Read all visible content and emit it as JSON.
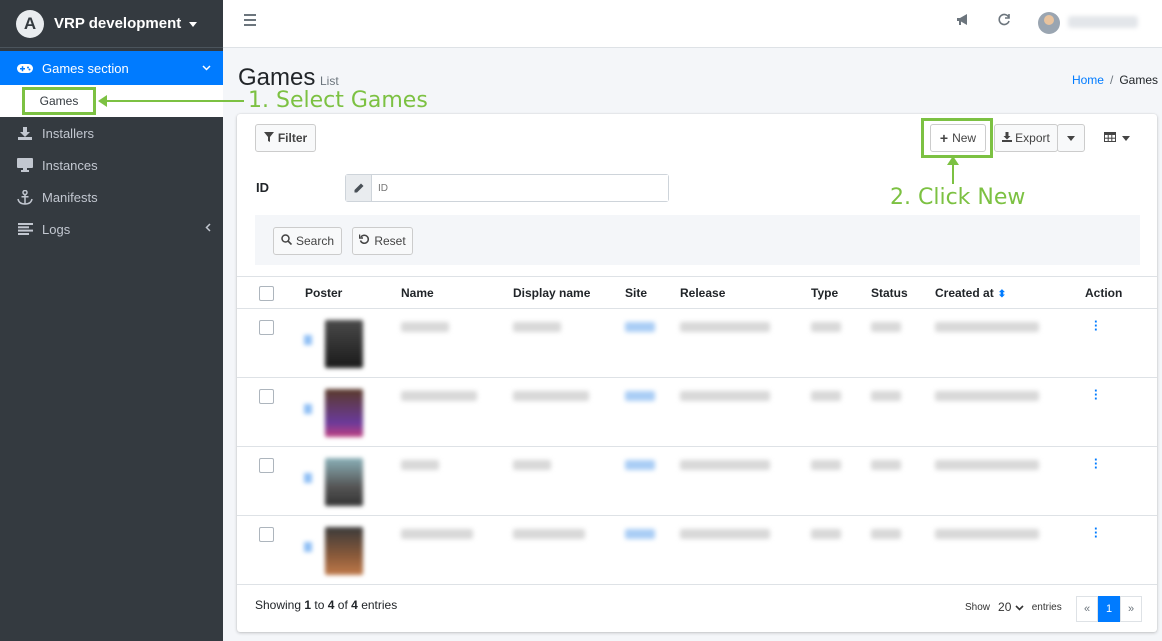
{
  "brand": {
    "name": "VRP development",
    "logo_letter": "A"
  },
  "sidebar": {
    "items": [
      {
        "label": "Games section",
        "icon": "gamepad-icon"
      },
      {
        "label": "Games"
      },
      {
        "label": "Installers",
        "icon": "download-icon"
      },
      {
        "label": "Instances",
        "icon": "desktop-icon"
      },
      {
        "label": "Manifests",
        "icon": "anchor-icon"
      },
      {
        "label": "Logs",
        "icon": "list-icon"
      }
    ]
  },
  "header": {
    "title": "Games",
    "subtitle": "List"
  },
  "breadcrumb": {
    "home": "Home",
    "separator": "/",
    "current": "Games"
  },
  "toolbar": {
    "filter_label": "Filter",
    "new_label": "New",
    "export_label": "Export"
  },
  "filter": {
    "id_label": "ID",
    "id_placeholder": "ID",
    "search_label": "Search",
    "reset_label": "Reset"
  },
  "table": {
    "columns": [
      "Poster",
      "Name",
      "Display name",
      "Site",
      "Release",
      "Type",
      "Status",
      "Created at",
      "Action"
    ],
    "row_count": 4
  },
  "footer": {
    "showing_prefix": "Showing",
    "from": "1",
    "to_word": "to",
    "to": "4",
    "of_word": "of",
    "total": "4",
    "entries_word": "entries",
    "show_label": "Show",
    "per_page": "20",
    "entries_label": "entries",
    "prev": "«",
    "page": "1",
    "next": "»"
  },
  "annotations": {
    "step1": "1. Select Games",
    "step2": "2. Click New"
  },
  "colors": {
    "accent": "#007bff",
    "sidebar_bg": "#343a40",
    "highlight": "#7cc142"
  }
}
